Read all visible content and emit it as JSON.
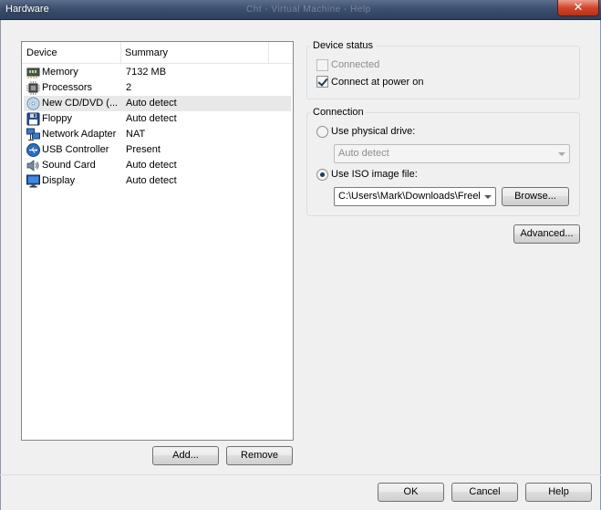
{
  "window": {
    "title": "Hardware",
    "background_title": "Cht - Virtual Machine - Help",
    "close_label": "✕"
  },
  "device_list": {
    "columns": [
      "Device",
      "Summary"
    ],
    "items": [
      {
        "name": "Memory",
        "summary": "7132 MB",
        "icon": "memory-icon"
      },
      {
        "name": "Processors",
        "summary": "2",
        "icon": "processor-icon"
      },
      {
        "name": "New CD/DVD (...",
        "summary": "Auto detect",
        "icon": "cd-dvd-icon",
        "selected": true
      },
      {
        "name": "Floppy",
        "summary": "Auto detect",
        "icon": "floppy-icon"
      },
      {
        "name": "Network Adapter",
        "summary": "NAT",
        "icon": "network-adapter-icon"
      },
      {
        "name": "USB Controller",
        "summary": "Present",
        "icon": "usb-icon"
      },
      {
        "name": "Sound Card",
        "summary": "Auto detect",
        "icon": "sound-card-icon"
      },
      {
        "name": "Display",
        "summary": "Auto detect",
        "icon": "display-icon"
      }
    ]
  },
  "list_buttons": {
    "add": "Add...",
    "remove": "Remove"
  },
  "device_status": {
    "label": "Device status",
    "connected": {
      "label": "Connected",
      "checked": false,
      "disabled": true
    },
    "connect_at_power_on": {
      "label": "Connect at power on",
      "checked": true
    }
  },
  "connection": {
    "label": "Connection",
    "physical_drive": {
      "label": "Use physical drive:",
      "selected": false,
      "value": "Auto detect"
    },
    "iso_image": {
      "label": "Use ISO image file:",
      "selected": true,
      "value": "C:\\Users\\Mark\\Downloads\\Freel"
    },
    "browse": "Browse..."
  },
  "advanced": "Advanced...",
  "footer": {
    "ok": "OK",
    "cancel": "Cancel",
    "help": "Help"
  },
  "colors": {
    "titlebar": "#3d5070",
    "close": "#d2452a",
    "window_bg": "#f0f0f0",
    "list_bg": "#ffffff",
    "selection": "#e8e8e8"
  }
}
